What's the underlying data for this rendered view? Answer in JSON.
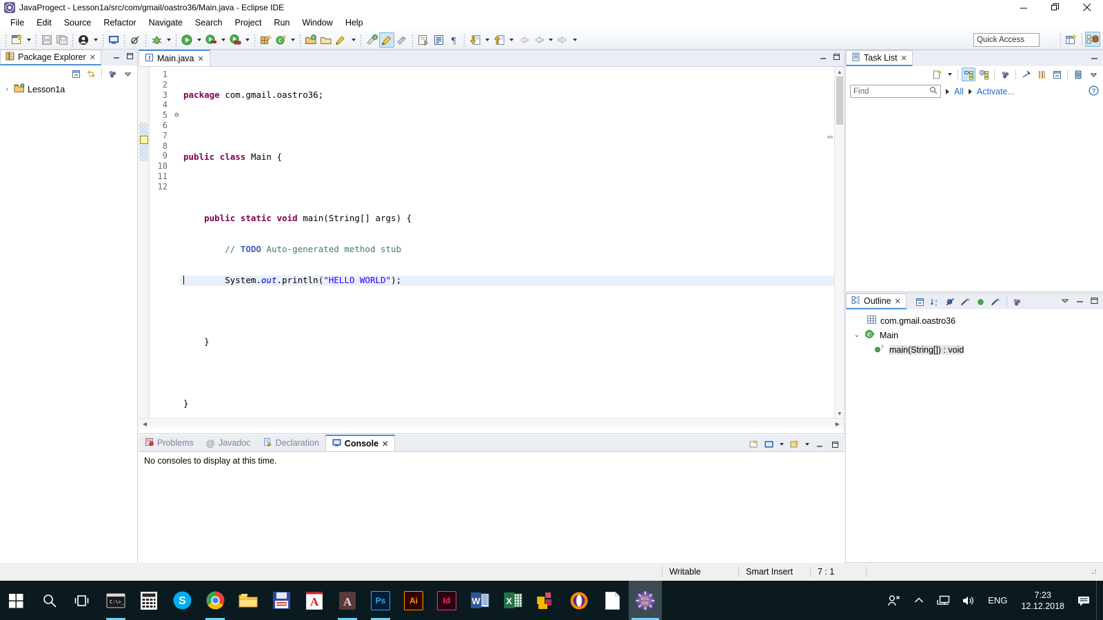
{
  "window": {
    "title": "JavaProgect - Lesson1a/src/com/gmail/oastro36/Main.java - Eclipse IDE",
    "icon": "eclipse-icon",
    "controls": {
      "minimize": "minimize-icon",
      "maximize": "maximize-icon",
      "close": "close-icon"
    }
  },
  "menubar": {
    "items": [
      "File",
      "Edit",
      "Source",
      "Refactor",
      "Navigate",
      "Search",
      "Project",
      "Run",
      "Window",
      "Help"
    ]
  },
  "toolbar": {
    "quick_access_placeholder": "Quick Access",
    "buttons": [
      "new-wizard-icon",
      "save-icon",
      "save-all-icon",
      "user-icon",
      "open-console-icon",
      "skip-breakpoints-icon",
      "debug-icon",
      "run-icon",
      "coverage-icon",
      "run-last-tool-icon",
      "new-java-package-icon",
      "new-java-class-icon",
      "open-type-icon",
      "open-task-icon",
      "toggle-mark-occurrences-icon",
      "link-with-editor-icon",
      "export-icon",
      "show-whitespace-icon",
      "pilcrow-icon",
      "next-annotation-icon",
      "previous-annotation-icon",
      "back-icon",
      "forward-icon"
    ],
    "perspective_buttons": [
      "open-perspective-icon",
      "java-perspective-icon"
    ]
  },
  "package_explorer": {
    "tab_label": "Package Explorer",
    "tab_icon": "package-explorer-icon",
    "close_icon": "close-tab-icon",
    "tools": [
      "collapse-all-icon",
      "link-with-editor-icon",
      "view-menu-dots-icon",
      "view-menu-icon"
    ],
    "min_icon": "minimize-icon",
    "max_icon": "maximize-icon",
    "tree": [
      {
        "label": "Lesson1a",
        "icon": "java-project-icon",
        "expanded": false,
        "twisty": "›"
      }
    ]
  },
  "editor": {
    "tab_label": "Main.java",
    "tab_icon": "java-file-icon",
    "close_icon": "close-tab-icon",
    "min_icon": "minimize-icon",
    "max_icon": "maximize-icon",
    "cursor_line": 7,
    "lines": [
      {
        "no": "1",
        "fold": "",
        "current": false
      },
      {
        "no": "2",
        "fold": "",
        "current": false
      },
      {
        "no": "3",
        "fold": "",
        "current": false
      },
      {
        "no": "4",
        "fold": "",
        "current": false
      },
      {
        "no": "5",
        "fold": "⊖",
        "current": false
      },
      {
        "no": "6",
        "fold": "",
        "current": false
      },
      {
        "no": "7",
        "fold": "",
        "current": true
      },
      {
        "no": "8",
        "fold": "",
        "current": false
      },
      {
        "no": "9",
        "fold": "",
        "current": false
      },
      {
        "no": "10",
        "fold": "",
        "current": false
      },
      {
        "no": "11",
        "fold": "",
        "current": false
      },
      {
        "no": "12",
        "fold": "",
        "current": false
      }
    ],
    "code": {
      "l1_kw": "package",
      "l1_rest": " com.gmail.oastro36;",
      "l3_kw1": "public",
      "l3_kw2": "class",
      "l3_rest": " Main {",
      "l5_indent": "    ",
      "l5_kw1": "public",
      "l5_kw2": "static",
      "l5_kw3": "void",
      "l5_rest": " main(String[] args) {",
      "l6_indent": "        ",
      "l6_comment_pre": "// ",
      "l6_todo": "TODO",
      "l6_comment_post": " Auto-generated method stub",
      "l7_indent": "        ",
      "l7_pre": "System.",
      "l7_field": "out",
      "l7_mid": ".println(",
      "l7_string": "\"HELLO WORLD\"",
      "l7_post": ");",
      "l9": "    }",
      "l11": "}"
    }
  },
  "bottom_panel": {
    "tabs": [
      {
        "label": "Problems",
        "icon": "problems-icon",
        "selected": false
      },
      {
        "label": "Javadoc",
        "icon": "javadoc-icon",
        "selected": false
      },
      {
        "label": "Declaration",
        "icon": "declaration-icon",
        "selected": false
      },
      {
        "label": "Console",
        "icon": "console-icon",
        "selected": true
      }
    ],
    "close_icon": "close-tab-icon",
    "message": "No consoles to display at this time.",
    "tools": [
      "open-console-icon",
      "display-selected-console-icon",
      "pin-console-icon",
      "view-menu-icon",
      "minimize-icon",
      "maximize-icon"
    ]
  },
  "task_list": {
    "tab_label": "Task List",
    "tab_icon": "task-list-icon",
    "close_icon": "close-tab-icon",
    "find_placeholder": "Find",
    "search_icon": "search-icon",
    "filter_all_label": "All",
    "activate_label": "Activate...",
    "help_icon": "help-icon",
    "tools": [
      "new-task-icon",
      "categorize-icon",
      "schedule-icon",
      "focus-icon",
      "filter-icon",
      "synchronize-icon",
      "collapse-all-icon",
      "restore-icon"
    ],
    "min_icon": "minimize-icon",
    "view_menu_icon": "view-menu-icon"
  },
  "outline": {
    "tab_label": "Outline",
    "tab_icon": "outline-icon",
    "close_icon": "close-tab-icon",
    "tools": [
      "collapse-all-icon",
      "sort-icon",
      "hide-fields-icon",
      "hide-static-icon",
      "hide-nonpublic-icon",
      "hide-local-types-icon",
      "view-menu-dots-icon"
    ],
    "view_menu_icon": "view-menu-icon",
    "min_icon": "minimize-icon",
    "max_icon": "maximize-icon",
    "tree": [
      {
        "label": "com.gmail.oastro36",
        "icon": "package-icon",
        "indent": 1,
        "twisty": "",
        "selected": false
      },
      {
        "label": "Main",
        "icon": "class-icon",
        "indent": 0,
        "twisty": "⌄",
        "selected": false
      },
      {
        "label": "main(String[]) : void",
        "icon": "method-public-static-icon",
        "indent": 2,
        "twisty": "",
        "selected": true
      }
    ]
  },
  "statusbar": {
    "writable": "Writable",
    "insert_mode": "Smart Insert",
    "position": "7 : 1"
  },
  "taskbar": {
    "start_icon": "windows-start-icon",
    "search_icon": "search-icon",
    "taskview_icon": "task-view-icon",
    "apps": [
      {
        "name": "command-prompt-icon",
        "label": "",
        "running": true,
        "focused": false
      },
      {
        "name": "calculator-icon",
        "label": "",
        "running": false,
        "focused": false
      },
      {
        "name": "skype-icon",
        "label": "S",
        "running": false,
        "focused": false
      },
      {
        "name": "chrome-icon",
        "label": "",
        "running": true,
        "focused": false
      },
      {
        "name": "file-explorer-icon",
        "label": "",
        "running": false,
        "focused": false
      },
      {
        "name": "save-app-icon",
        "label": "",
        "running": false,
        "focused": false
      },
      {
        "name": "acrobat-reader-icon",
        "label": "",
        "running": false,
        "focused": false
      },
      {
        "name": "acrobat-dc-icon",
        "label": "",
        "running": true,
        "focused": false
      },
      {
        "name": "photoshop-icon",
        "label": "Ps",
        "running": true,
        "focused": false
      },
      {
        "name": "illustrator-icon",
        "label": "Ai",
        "running": false,
        "focused": false
      },
      {
        "name": "indesign-icon",
        "label": "Id",
        "running": false,
        "focused": false
      },
      {
        "name": "word-icon",
        "label": "W",
        "running": false,
        "focused": false
      },
      {
        "name": "excel-icon",
        "label": "X",
        "running": false,
        "focused": false
      },
      {
        "name": "sticky-notes-icon",
        "label": "",
        "running": false,
        "focused": false
      },
      {
        "name": "opera-icon",
        "label": "",
        "running": false,
        "focused": false
      },
      {
        "name": "notepad-icon",
        "label": "",
        "running": false,
        "focused": false
      },
      {
        "name": "eclipse-icon",
        "label": "",
        "running": true,
        "focused": true
      }
    ],
    "tray": {
      "people_icon": "people-icon",
      "chevron_icon": "show-hidden-icons-icon",
      "network_icon": "network-icon",
      "volume_icon": "volume-icon",
      "language": "ENG",
      "time": "7:23",
      "date": "12.12.2018",
      "action_center_icon": "action-center-icon"
    }
  },
  "colors": {
    "accent": "#4a90d9",
    "keyword": "#7f0055",
    "string": "#2a00ff",
    "comment": "#3f7f5f",
    "todo": "#3f5fbf",
    "field": "#0000c0",
    "link": "#1a6fc4",
    "taskbar_bg": "#0a1a1f"
  }
}
